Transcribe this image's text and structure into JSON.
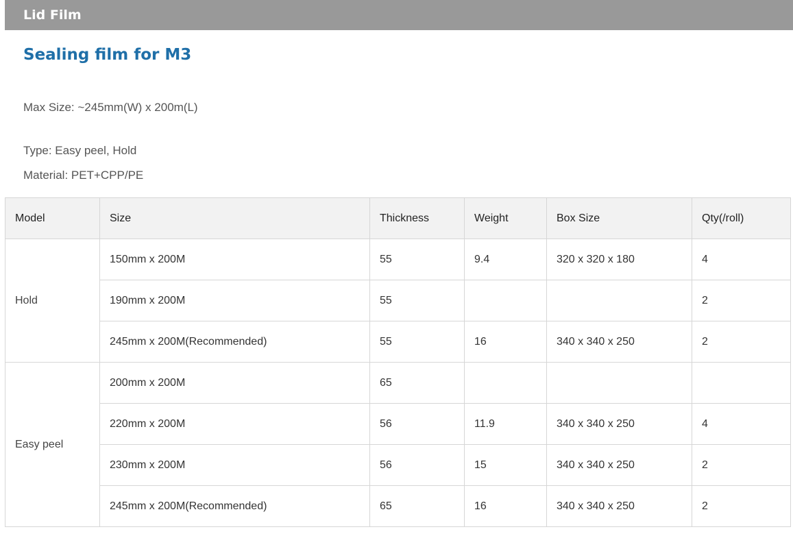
{
  "section": {
    "title": "Lid Film"
  },
  "product": {
    "title": "Sealing film for M3",
    "max_size": "Max Size: ~245mm(W) x 200m(L)",
    "type": "Type: Easy peel, Hold",
    "material": "Material: PET+CPP/PE"
  },
  "table": {
    "headers": [
      "Model",
      "Size",
      "Thickness",
      "Weight",
      "Box Size",
      "Qty(/roll)"
    ],
    "groups": [
      {
        "model": "Hold",
        "rows": [
          [
            "150mm x 200M",
            "55",
            "9.4",
            "320 x 320 x 180",
            "4"
          ],
          [
            "190mm x 200M",
            "55",
            "",
            "",
            "2"
          ],
          [
            "245mm x 200M(Recommended)",
            "55",
            "16",
            "340 x 340 x 250",
            "2"
          ]
        ]
      },
      {
        "model": "Easy peel",
        "rows": [
          [
            "200mm x 200M",
            "65",
            "",
            "",
            ""
          ],
          [
            "220mm x 200M",
            "56",
            "11.9",
            "340 x 340 x 250",
            "4"
          ],
          [
            "230mm x 200M",
            "56",
            "15",
            "340 x 340 x 250",
            "2"
          ],
          [
            "245mm x 200M(Recommended)",
            "65",
            "16",
            "340 x 340 x 250",
            "2"
          ]
        ]
      }
    ]
  }
}
